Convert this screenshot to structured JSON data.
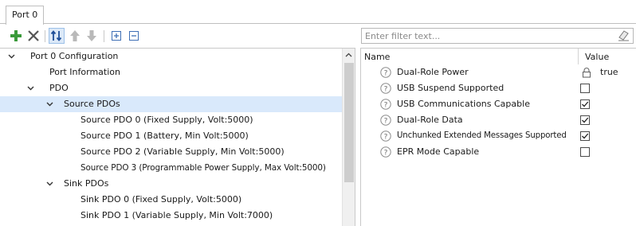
{
  "tab": {
    "label": "Port 0"
  },
  "toolbar": {
    "add_icon": "plus-icon",
    "delete_icon": "x-icon",
    "sort_icon": "sort-icon",
    "move_up_icon": "arrow-up-icon",
    "move_down_icon": "arrow-down-icon",
    "expand_all_icon": "expand-all-icon",
    "collapse_all_icon": "collapse-all-icon"
  },
  "tree": {
    "items": [
      {
        "label": "Port 0 Configuration",
        "expanded": true,
        "selected": false
      },
      {
        "label": "Port Information",
        "expanded": null,
        "selected": false
      },
      {
        "label": "PDO",
        "expanded": true,
        "selected": false
      },
      {
        "label": "Source PDOs",
        "expanded": true,
        "selected": true
      },
      {
        "label": "Source PDO 0 (Fixed Supply, Volt:5000)",
        "expanded": null,
        "selected": false
      },
      {
        "label": "Source PDO 1 (Battery, Min Volt:5000)",
        "expanded": null,
        "selected": false
      },
      {
        "label": "Source PDO 2 (Variable Supply, Min Volt:5000)",
        "expanded": null,
        "selected": false
      },
      {
        "label": "Source PDO 3 (Programmable Power Supply, Max Volt:5000)",
        "expanded": null,
        "selected": false
      },
      {
        "label": "Sink PDOs",
        "expanded": true,
        "selected": false
      },
      {
        "label": "Sink PDO 0 (Fixed Supply, Volt:5000)",
        "expanded": null,
        "selected": false
      },
      {
        "label": "Sink PDO 1 (Variable Supply, Min Volt:7000)",
        "expanded": null,
        "selected": false
      }
    ]
  },
  "filter": {
    "placeholder": "Enter filter text..."
  },
  "grid": {
    "header_name": "Name",
    "header_value": "Value",
    "rows": [
      {
        "name": "Dual-Role Power",
        "value_text": "true",
        "checked": null,
        "locked": true
      },
      {
        "name": "USB Suspend Supported",
        "value_text": "",
        "checked": false,
        "locked": false
      },
      {
        "name": "USB Communications Capable",
        "value_text": "",
        "checked": true,
        "locked": false
      },
      {
        "name": "Dual-Role Data",
        "value_text": "",
        "checked": true,
        "locked": false
      },
      {
        "name": "Unchunked Extended Messages Supported",
        "value_text": "",
        "checked": true,
        "locked": false
      },
      {
        "name": "EPR Mode Capable",
        "value_text": "",
        "checked": false,
        "locked": false
      }
    ]
  },
  "colors": {
    "selection": "#d9e9fb",
    "add_green": "#3a9a3a",
    "sort_blue": "#1f4f99",
    "disabled_gray": "#b9b9b9"
  }
}
